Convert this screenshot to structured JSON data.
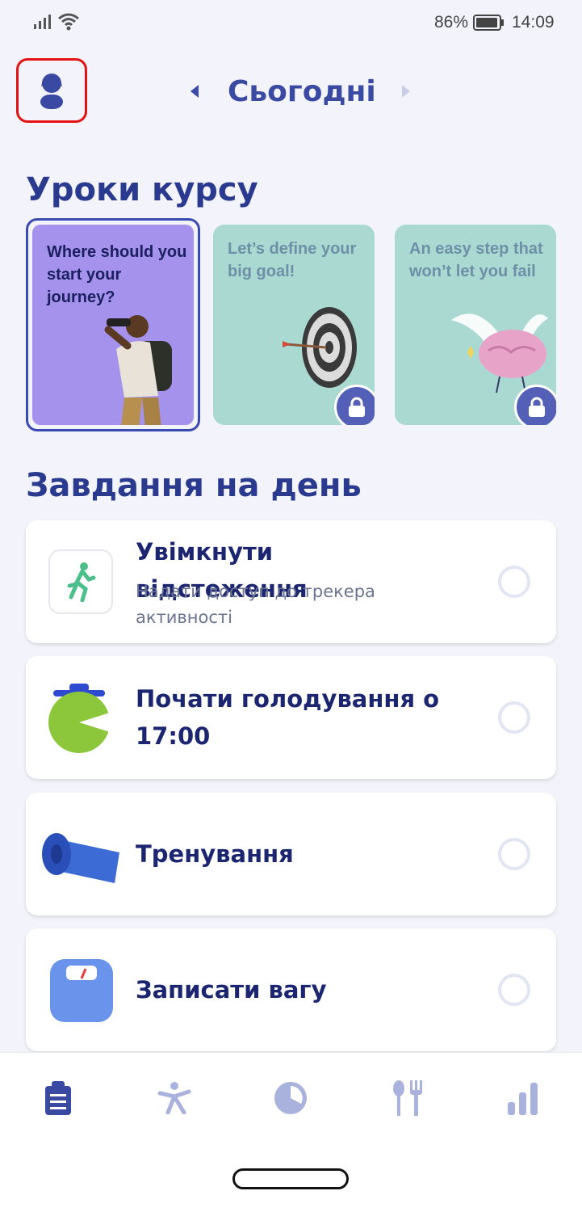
{
  "status_bar": {
    "battery": "86%",
    "time": "14:09"
  },
  "header": {
    "date_title": "Сьогодні"
  },
  "lessons": {
    "section_title": "Уроки курсу",
    "cards": [
      {
        "text": "Where should you start your journey?",
        "locked": false
      },
      {
        "text": "Let’s define your big goal!",
        "locked": true
      },
      {
        "text": "An easy step that won’t let you fail",
        "locked": true
      }
    ]
  },
  "tasks": {
    "section_title": "Завдання на день",
    "items": [
      {
        "title": "Увімкнути відстеження",
        "subtitle": "Надати доступ до трекера активності",
        "icon": "running-person-icon"
      },
      {
        "title": "Почати голодування о 17:00",
        "icon": "fasting-timer-icon"
      },
      {
        "title": "Тренування",
        "icon": "yoga-mat-icon"
      },
      {
        "title": "Записати вагу",
        "icon": "scale-icon"
      }
    ]
  },
  "bottom_nav": {
    "items": [
      "clipboard-icon",
      "activity-icon",
      "fasting-icon",
      "food-icon",
      "stats-icon"
    ],
    "active": "clipboard-icon"
  },
  "colors": {
    "accent": "#3a4aa3",
    "lesson_active": "#a592ec",
    "lesson_locked": "#aad9d2",
    "highlight": "#e41212"
  }
}
